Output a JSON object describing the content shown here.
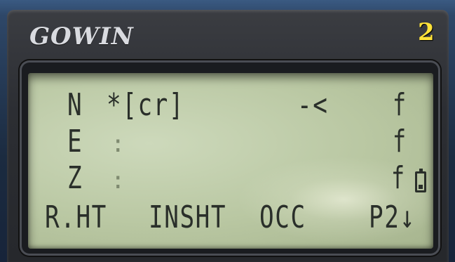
{
  "brand": "GOWIN",
  "page_indicator": "2",
  "display": {
    "rows": [
      {
        "label": "N",
        "value": "*[cr]",
        "unit": "f"
      },
      {
        "label": "E",
        "value": ":",
        "unit": "f"
      },
      {
        "label": "Z",
        "value": ":",
        "unit": "f"
      }
    ],
    "direction_indicator": "-<",
    "battery_level": 0.3,
    "softkeys": {
      "f1": "R.HT",
      "f2": "INSHT",
      "f3": "OCC",
      "f4": "P2↓"
    }
  }
}
